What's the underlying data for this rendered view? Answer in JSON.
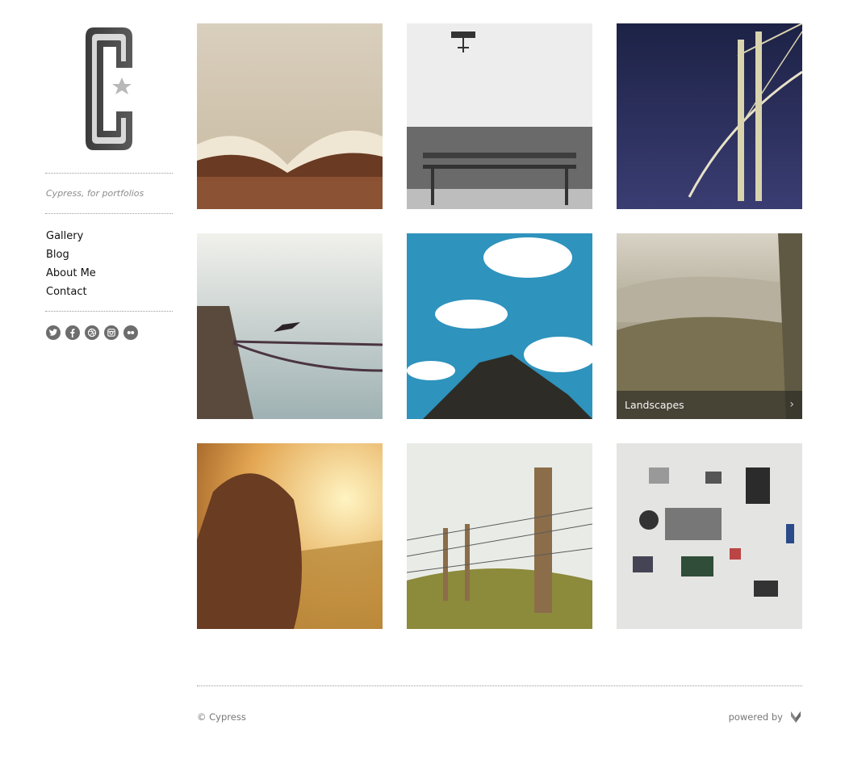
{
  "site": {
    "tagline": "Cypress, for portfolios"
  },
  "nav": {
    "items": [
      {
        "label": "Gallery"
      },
      {
        "label": "Blog"
      },
      {
        "label": "About Me"
      },
      {
        "label": "Contact"
      }
    ]
  },
  "social": [
    "twitter-icon",
    "facebook-icon",
    "dribbble-icon",
    "instagram-icon",
    "flickr-icon"
  ],
  "gallery": {
    "items": [
      {
        "subject": "open book"
      },
      {
        "subject": "bench against white wall"
      },
      {
        "subject": "bridge at night"
      },
      {
        "subject": "cormorant on boat rope"
      },
      {
        "subject": "people on mountain under clouds"
      },
      {
        "subject": "misty landscape",
        "caption": "Landscapes"
      },
      {
        "subject": "girl in golden field"
      },
      {
        "subject": "barbed wire fence post"
      },
      {
        "subject": "disassembled camera parts"
      }
    ]
  },
  "footer": {
    "copyright": "© Cypress",
    "powered_by": "powered by"
  },
  "colors": {
    "text": "#222222",
    "muted": "#8c8c8c",
    "icon": "#6d6d6d"
  }
}
